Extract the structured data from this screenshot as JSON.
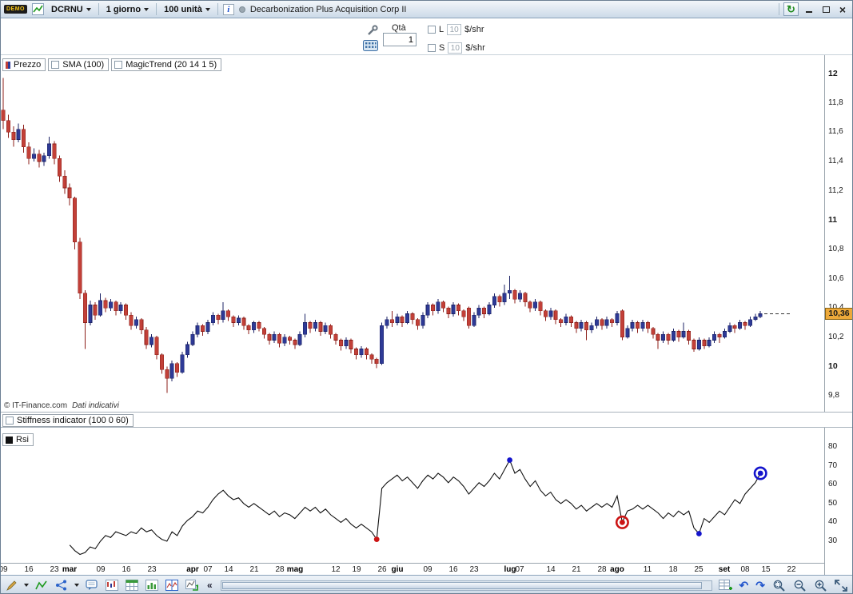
{
  "titlebar": {
    "demo_label": "DEMO",
    "symbol": "DCRNU",
    "timeframe": "1 giorno",
    "units": "100 unità",
    "title": "Decarbonization Plus Acquisition Corp II"
  },
  "icons": {
    "info": "i",
    "refresh": "↻",
    "close": "×",
    "collapse_left": "«",
    "undo": "↶",
    "redo": "↷"
  },
  "order_panel": {
    "qty_label": "Qtà",
    "qty_value": "1",
    "long": {
      "label": "L",
      "value": "10",
      "unit": "$/shr",
      "checked": false
    },
    "short": {
      "label": "S",
      "value": "10",
      "unit": "$/shr",
      "checked": false
    }
  },
  "price_pane": {
    "legend_label": "Prezzo",
    "indicators": [
      {
        "label": "SMA (100)",
        "checked": false
      },
      {
        "label": "MagicTrend (20 14 1 5)",
        "checked": false
      }
    ],
    "copyright": "© IT-Finance.com",
    "disclaimer": "Dati indicativi",
    "last_price": "10,36"
  },
  "stiffness": {
    "label": "Stiffness indicator (100 0 60)",
    "checked": false
  },
  "rsi_pane": {
    "label": "Rsi"
  },
  "chart_data": [
    {
      "type": "candlestick",
      "title": "Prezzo",
      "ylim": [
        9.697,
        12.126
      ],
      "yticks": [
        {
          "v": 12,
          "b": 1
        },
        {
          "v": 11.8,
          "b": 0
        },
        {
          "v": 11.6,
          "b": 0
        },
        {
          "v": 11.4,
          "b": 0
        },
        {
          "v": 11.2,
          "b": 0
        },
        {
          "v": 11,
          "b": 1
        },
        {
          "v": 10.8,
          "b": 0
        },
        {
          "v": 10.6,
          "b": 0
        },
        {
          "v": 10.4,
          "b": 0
        },
        {
          "v": 10.2,
          "b": 0
        },
        {
          "v": 10,
          "b": 1
        },
        {
          "v": 9.8,
          "b": 0
        }
      ],
      "last_price": 10.36,
      "colors": {
        "up": "#2e3a96",
        "up_stroke": "#1c2366",
        "down": "#c24038",
        "down_stroke": "#8c1f1a"
      },
      "x_ticks": [
        {
          "label": "09",
          "i": 0
        },
        {
          "label": "16",
          "i": 5
        },
        {
          "label": "23",
          "i": 10
        },
        {
          "label": "mar",
          "i": 13,
          "bold": true
        },
        {
          "label": "09",
          "i": 19
        },
        {
          "label": "16",
          "i": 24
        },
        {
          "label": "23",
          "i": 29
        },
        {
          "label": "apr",
          "i": 37,
          "bold": true
        },
        {
          "label": "07",
          "i": 40
        },
        {
          "label": "14",
          "i": 44
        },
        {
          "label": "21",
          "i": 49
        },
        {
          "label": "28",
          "i": 54
        },
        {
          "label": "mag",
          "i": 57,
          "bold": true
        },
        {
          "label": "12",
          "i": 65
        },
        {
          "label": "19",
          "i": 69
        },
        {
          "label": "26",
          "i": 74
        },
        {
          "label": "giu",
          "i": 77,
          "bold": true
        },
        {
          "label": "09",
          "i": 83
        },
        {
          "label": "16",
          "i": 88
        },
        {
          "label": "23",
          "i": 92
        },
        {
          "label": "lug",
          "i": 99,
          "bold": true
        },
        {
          "label": "07",
          "i": 101
        },
        {
          "label": "14",
          "i": 107
        },
        {
          "label": "21",
          "i": 112
        },
        {
          "label": "28",
          "i": 117
        },
        {
          "label": "ago",
          "i": 120,
          "bold": true
        },
        {
          "label": "11",
          "i": 126
        },
        {
          "label": "18",
          "i": 131
        },
        {
          "label": "25",
          "i": 136
        },
        {
          "label": "set",
          "i": 141,
          "bold": true
        },
        {
          "label": "08",
          "i": 145
        },
        {
          "label": "15",
          "i": 149
        },
        {
          "label": "22",
          "i": 154
        }
      ],
      "candles": [
        [
          11.75,
          11.97,
          11.62,
          11.68
        ],
        [
          11.68,
          11.72,
          11.56,
          11.6
        ],
        [
          11.6,
          11.64,
          11.5,
          11.55
        ],
        [
          11.55,
          11.66,
          11.53,
          11.62
        ],
        [
          11.62,
          11.65,
          11.46,
          11.5
        ],
        [
          11.5,
          11.53,
          11.38,
          11.42
        ],
        [
          11.42,
          11.49,
          11.4,
          11.45
        ],
        [
          11.45,
          11.48,
          11.36,
          11.4
        ],
        [
          11.4,
          11.46,
          11.37,
          11.44
        ],
        [
          11.44,
          11.57,
          11.42,
          11.52
        ],
        [
          11.52,
          11.54,
          11.38,
          11.42
        ],
        [
          11.42,
          11.44,
          11.26,
          11.3
        ],
        [
          11.3,
          11.34,
          11.18,
          11.22
        ],
        [
          11.22,
          11.25,
          11.1,
          11.15
        ],
        [
          11.15,
          11.16,
          10.8,
          10.85
        ],
        [
          10.85,
          10.88,
          10.46,
          10.5
        ],
        [
          10.5,
          10.52,
          10.12,
          10.3
        ],
        [
          10.3,
          10.45,
          10.28,
          10.42
        ],
        [
          10.42,
          10.44,
          10.32,
          10.35
        ],
        [
          10.35,
          10.5,
          10.34,
          10.45
        ],
        [
          10.45,
          10.47,
          10.37,
          10.4
        ],
        [
          10.4,
          10.46,
          10.38,
          10.44
        ],
        [
          10.44,
          10.45,
          10.35,
          10.38
        ],
        [
          10.38,
          10.44,
          10.36,
          10.42
        ],
        [
          10.42,
          10.43,
          10.32,
          10.35
        ],
        [
          10.35,
          10.37,
          10.25,
          10.28
        ],
        [
          10.28,
          10.34,
          10.26,
          10.32
        ],
        [
          10.32,
          10.33,
          10.22,
          10.25
        ],
        [
          10.25,
          10.27,
          10.12,
          10.15
        ],
        [
          10.15,
          10.22,
          10.13,
          10.2
        ],
        [
          10.2,
          10.21,
          10.05,
          10.08
        ],
        [
          10.08,
          10.09,
          9.95,
          9.98
        ],
        [
          9.98,
          10.0,
          9.82,
          9.92
        ],
        [
          9.92,
          10.04,
          9.9,
          10.02
        ],
        [
          10.02,
          10.03,
          9.93,
          9.96
        ],
        [
          9.96,
          10.1,
          9.95,
          10.08
        ],
        [
          10.08,
          10.17,
          10.06,
          10.15
        ],
        [
          10.15,
          10.24,
          10.14,
          10.22
        ],
        [
          10.22,
          10.3,
          10.2,
          10.28
        ],
        [
          10.28,
          10.29,
          10.21,
          10.24
        ],
        [
          10.24,
          10.32,
          10.22,
          10.3
        ],
        [
          10.3,
          10.37,
          10.28,
          10.35
        ],
        [
          10.35,
          10.36,
          10.29,
          10.32
        ],
        [
          10.32,
          10.44,
          10.3,
          10.38
        ],
        [
          10.38,
          10.39,
          10.31,
          10.34
        ],
        [
          10.34,
          10.35,
          10.27,
          10.3
        ],
        [
          10.3,
          10.35,
          10.28,
          10.33
        ],
        [
          10.33,
          10.34,
          10.25,
          10.28
        ],
        [
          10.28,
          10.29,
          10.22,
          10.25
        ],
        [
          10.25,
          10.31,
          10.23,
          10.3
        ],
        [
          10.3,
          10.31,
          10.24,
          10.26
        ],
        [
          10.26,
          10.27,
          10.19,
          10.22
        ],
        [
          10.22,
          10.23,
          10.15,
          10.18
        ],
        [
          10.18,
          10.24,
          10.16,
          10.22
        ],
        [
          10.22,
          10.23,
          10.13,
          10.16
        ],
        [
          10.16,
          10.22,
          10.14,
          10.2
        ],
        [
          10.2,
          10.21,
          10.15,
          10.18
        ],
        [
          10.18,
          10.19,
          10.12,
          10.15
        ],
        [
          10.15,
          10.24,
          10.14,
          10.22
        ],
        [
          10.22,
          10.36,
          10.2,
          10.3
        ],
        [
          10.3,
          10.31,
          10.23,
          10.26
        ],
        [
          10.26,
          10.32,
          10.24,
          10.3
        ],
        [
          10.3,
          10.31,
          10.21,
          10.24
        ],
        [
          10.24,
          10.3,
          10.22,
          10.28
        ],
        [
          10.28,
          10.29,
          10.19,
          10.22
        ],
        [
          10.22,
          10.23,
          10.15,
          10.18
        ],
        [
          10.18,
          10.19,
          10.11,
          10.14
        ],
        [
          10.14,
          10.2,
          10.12,
          10.18
        ],
        [
          10.18,
          10.19,
          10.09,
          10.12
        ],
        [
          10.12,
          10.13,
          10.05,
          10.08
        ],
        [
          10.08,
          10.14,
          10.06,
          10.12
        ],
        [
          10.12,
          10.13,
          10.05,
          10.08
        ],
        [
          10.08,
          10.09,
          10.02,
          10.05
        ],
        [
          10.05,
          10.06,
          9.99,
          10.02
        ],
        [
          10.02,
          10.3,
          10.01,
          10.28
        ],
        [
          10.28,
          10.34,
          10.26,
          10.32
        ],
        [
          10.32,
          10.38,
          10.27,
          10.3
        ],
        [
          10.3,
          10.36,
          10.28,
          10.34
        ],
        [
          10.34,
          10.35,
          10.27,
          10.3
        ],
        [
          10.3,
          10.38,
          10.29,
          10.36
        ],
        [
          10.36,
          10.37,
          10.29,
          10.32
        ],
        [
          10.32,
          10.33,
          10.25,
          10.28
        ],
        [
          10.28,
          10.37,
          10.26,
          10.35
        ],
        [
          10.35,
          10.44,
          10.33,
          10.42
        ],
        [
          10.42,
          10.43,
          10.35,
          10.38
        ],
        [
          10.38,
          10.46,
          10.36,
          10.44
        ],
        [
          10.44,
          10.45,
          10.37,
          10.4
        ],
        [
          10.4,
          10.41,
          10.33,
          10.36
        ],
        [
          10.36,
          10.44,
          10.34,
          10.42
        ],
        [
          10.42,
          10.43,
          10.35,
          10.38
        ],
        [
          10.38,
          10.39,
          10.31,
          10.34
        ],
        [
          10.4,
          10.41,
          10.26,
          10.28
        ],
        [
          10.28,
          10.37,
          10.27,
          10.35
        ],
        [
          10.35,
          10.42,
          10.33,
          10.4
        ],
        [
          10.4,
          10.41,
          10.33,
          10.36
        ],
        [
          10.36,
          10.44,
          10.35,
          10.42
        ],
        [
          10.42,
          10.5,
          10.4,
          10.48
        ],
        [
          10.48,
          10.49,
          10.41,
          10.44
        ],
        [
          10.44,
          10.56,
          10.42,
          10.5
        ],
        [
          10.5,
          10.62,
          10.46,
          10.52
        ],
        [
          10.52,
          10.53,
          10.43,
          10.46
        ],
        [
          10.46,
          10.52,
          10.44,
          10.5
        ],
        [
          10.5,
          10.51,
          10.41,
          10.44
        ],
        [
          10.44,
          10.45,
          10.37,
          10.4
        ],
        [
          10.4,
          10.46,
          10.38,
          10.44
        ],
        [
          10.44,
          10.45,
          10.35,
          10.38
        ],
        [
          10.38,
          10.39,
          10.31,
          10.34
        ],
        [
          10.34,
          10.4,
          10.32,
          10.38
        ],
        [
          10.38,
          10.39,
          10.29,
          10.32
        ],
        [
          10.32,
          10.33,
          10.27,
          10.3
        ],
        [
          10.3,
          10.36,
          10.28,
          10.34
        ],
        [
          10.34,
          10.35,
          10.27,
          10.3
        ],
        [
          10.3,
          10.31,
          10.23,
          10.26
        ],
        [
          10.26,
          10.32,
          10.24,
          10.3
        ],
        [
          10.3,
          10.31,
          10.18,
          10.25
        ],
        [
          10.25,
          10.3,
          10.23,
          10.28
        ],
        [
          10.28,
          10.34,
          10.26,
          10.32
        ],
        [
          10.32,
          10.33,
          10.25,
          10.28
        ],
        [
          10.28,
          10.34,
          10.26,
          10.32
        ],
        [
          10.32,
          10.33,
          10.27,
          10.3
        ],
        [
          10.3,
          10.38,
          10.28,
          10.36
        ],
        [
          10.38,
          10.39,
          10.18,
          10.2
        ],
        [
          10.2,
          10.28,
          10.19,
          10.26
        ],
        [
          10.26,
          10.32,
          10.24,
          10.3
        ],
        [
          10.3,
          10.31,
          10.23,
          10.26
        ],
        [
          10.26,
          10.32,
          10.24,
          10.3
        ],
        [
          10.3,
          10.31,
          10.23,
          10.26
        ],
        [
          10.26,
          10.27,
          10.19,
          10.22
        ],
        [
          10.22,
          10.23,
          10.12,
          10.18
        ],
        [
          10.18,
          10.24,
          10.16,
          10.22
        ],
        [
          10.22,
          10.23,
          10.15,
          10.18
        ],
        [
          10.18,
          10.26,
          10.17,
          10.24
        ],
        [
          10.24,
          10.25,
          10.17,
          10.2
        ],
        [
          10.2,
          10.3,
          10.19,
          10.24
        ],
        [
          10.24,
          10.25,
          10.15,
          10.18
        ],
        [
          10.18,
          10.19,
          10.1,
          10.12
        ],
        [
          10.12,
          10.2,
          10.11,
          10.18
        ],
        [
          10.18,
          10.19,
          10.12,
          10.14
        ],
        [
          10.14,
          10.2,
          10.13,
          10.18
        ],
        [
          10.18,
          10.24,
          10.16,
          10.22
        ],
        [
          10.22,
          10.23,
          10.16,
          10.2
        ],
        [
          10.2,
          10.26,
          10.19,
          10.24
        ],
        [
          10.24,
          10.3,
          10.23,
          10.28
        ],
        [
          10.28,
          10.29,
          10.23,
          10.26
        ],
        [
          10.26,
          10.32,
          10.25,
          10.3
        ],
        [
          10.3,
          10.31,
          10.25,
          10.28
        ],
        [
          10.28,
          10.34,
          10.27,
          10.32
        ],
        [
          10.32,
          10.36,
          10.31,
          10.34
        ],
        [
          10.34,
          10.38,
          10.33,
          10.36
        ]
      ]
    },
    {
      "type": "line",
      "title": "Rsi",
      "ylim": [
        19.4,
        85.9
      ],
      "yticks": [
        80,
        70,
        60,
        50,
        40,
        30
      ],
      "line_color": "#111111",
      "start_index": 13,
      "values": [
        28,
        25,
        23,
        24,
        27,
        26,
        30,
        33,
        32,
        35,
        34,
        33,
        35,
        34,
        37,
        35,
        36,
        33,
        31,
        30,
        35,
        33,
        38,
        41,
        43,
        46,
        45,
        48,
        52,
        55,
        57,
        54,
        52,
        53,
        50,
        48,
        50,
        48,
        46,
        44,
        46,
        43,
        45,
        44,
        42,
        45,
        48,
        46,
        48,
        45,
        47,
        44,
        42,
        40,
        42,
        39,
        37,
        39,
        37,
        35,
        31,
        58,
        61,
        63,
        65,
        62,
        64,
        61,
        58,
        62,
        65,
        63,
        66,
        64,
        61,
        64,
        62,
        59,
        55,
        58,
        61,
        59,
        62,
        66,
        63,
        68,
        73,
        66,
        68,
        63,
        59,
        62,
        57,
        54,
        56,
        52,
        50,
        52,
        50,
        47,
        49,
        46,
        48,
        50,
        48,
        50,
        48,
        54,
        40,
        46,
        47,
        49,
        47,
        49,
        47,
        45,
        42,
        45,
        43,
        46,
        44,
        46,
        37,
        34,
        42,
        40,
        43,
        46,
        44,
        48,
        52,
        50,
        55,
        58,
        61,
        66
      ],
      "markers": [
        {
          "i": 73,
          "color": "#cc1414",
          "size": "small"
        },
        {
          "i": 99,
          "color": "#1414cc",
          "size": "small"
        },
        {
          "i": 121,
          "color": "#cc1414",
          "size": "big"
        },
        {
          "i": 136,
          "color": "#1414cc",
          "size": "small"
        },
        {
          "i": 148,
          "color": "#1414cc",
          "size": "big"
        }
      ]
    }
  ]
}
